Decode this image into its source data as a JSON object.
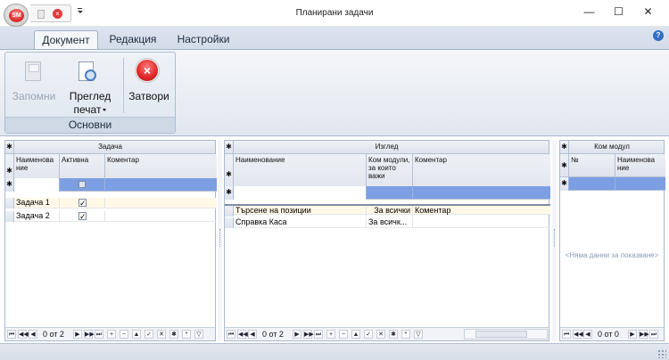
{
  "window": {
    "title": "Планирани задачи",
    "app_logo_text": "SM",
    "controls": {
      "minimize": "—",
      "maximize": "☐",
      "close": "✕"
    }
  },
  "ribbon": {
    "tabs": [
      {
        "label": "Документ",
        "active": true
      },
      {
        "label": "Редакция",
        "active": false
      },
      {
        "label": "Настройки",
        "active": false
      }
    ],
    "help": "?",
    "group": {
      "label": "Основни",
      "buttons": [
        {
          "line1": "Запомни",
          "line2": "",
          "enabled": false
        },
        {
          "line1": "Преглед",
          "line2": "печат",
          "enabled": true,
          "dropdown": true
        },
        {
          "line1": "Затвори",
          "line2": "",
          "enabled": true
        }
      ]
    }
  },
  "tasks_grid": {
    "group_header": "Задача",
    "columns": [
      "Наименова ние",
      "Активна",
      "Коментар"
    ],
    "rows": [
      {
        "name": "Задача 1",
        "active": "✓",
        "comment": ""
      },
      {
        "name": "Задача 2",
        "active": "✓",
        "comment": ""
      }
    ],
    "navigator": {
      "position": "0 от 2"
    }
  },
  "view_grid": {
    "group_header": "Изглед",
    "columns": [
      "Наименование",
      "Ком модули, за които важи",
      "Коментар"
    ],
    "rows": [
      {
        "name": "Търсене на позиции",
        "modules": "За всички",
        "comment": "Коментар"
      },
      {
        "name": "Справка Каса",
        "modules": "За всичк...",
        "comment": ""
      }
    ],
    "navigator": {
      "position": "0 от 2"
    }
  },
  "module_grid": {
    "group_header": "Ком модул",
    "columns": [
      "№",
      "Наименова ние"
    ],
    "empty_text": "<Няма данни за показване>",
    "navigator": {
      "position": "0 от 0"
    }
  },
  "navigator_glyphs": {
    "first": "⏮",
    "prev_page": "◀◀",
    "prev": "◀",
    "next": "▶",
    "next_page": "▶▶",
    "last": "⏭",
    "append": "+",
    "remove": "−",
    "edit": "▲",
    "post": "✓",
    "cancel": "✕",
    "refresh": "✱",
    "bookmark": "*",
    "filter": "▽"
  }
}
